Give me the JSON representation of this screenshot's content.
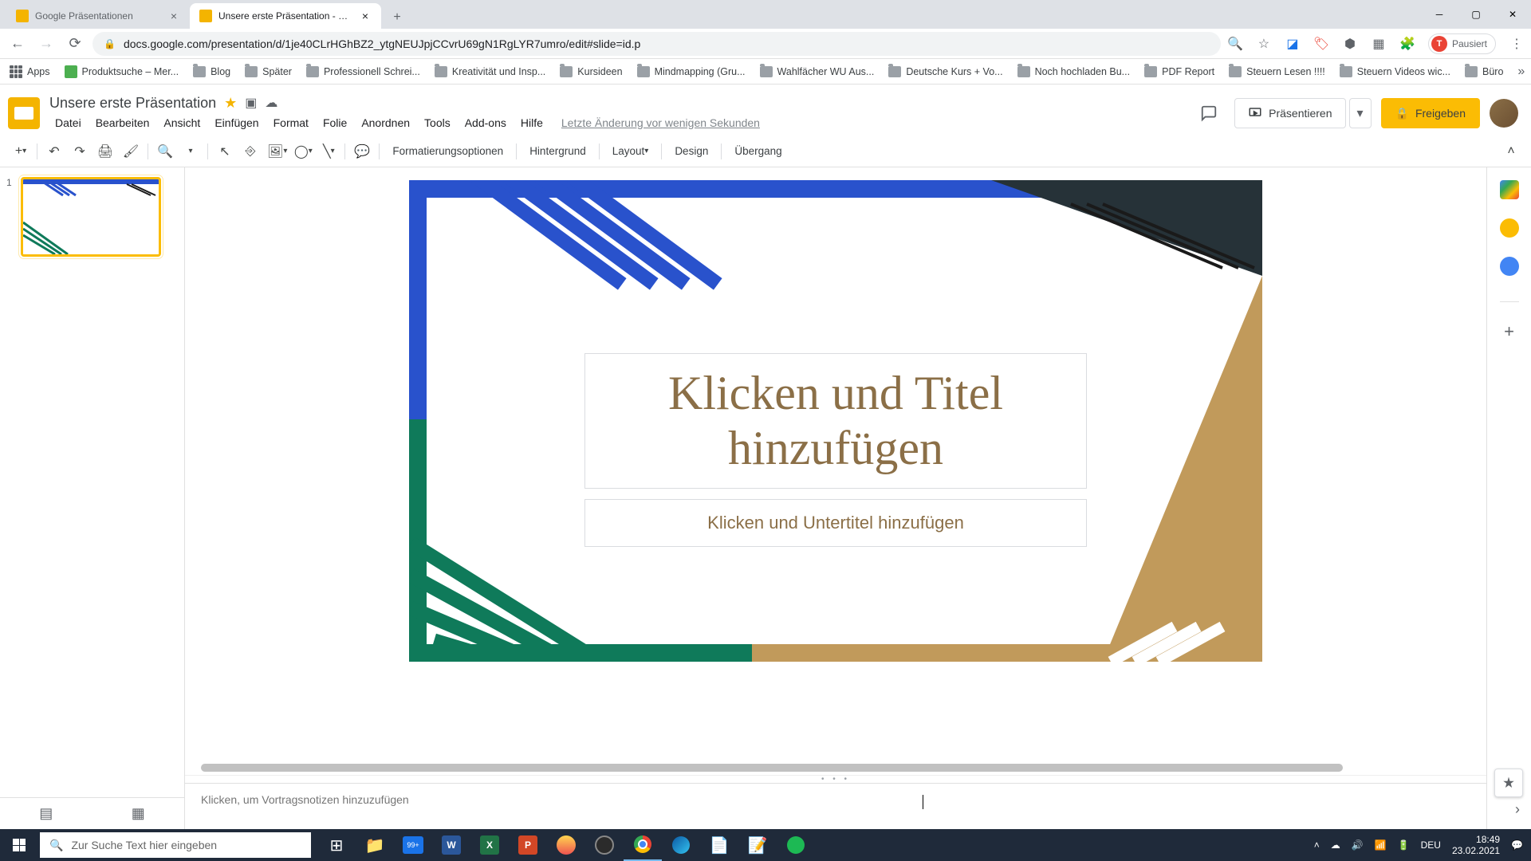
{
  "browser": {
    "tabs": [
      {
        "title": "Google Präsentationen",
        "active": false
      },
      {
        "title": "Unsere erste Präsentation - Goo...",
        "active": true
      }
    ],
    "url": "docs.google.com/presentation/d/1je40CLrHGhBZ2_ytgNEUJpjCCvrU69gN1RgLYR7umro/edit#slide=id.p",
    "pause_label": "Pausiert",
    "bookmarks": [
      "Apps",
      "Produktsuche – Mer...",
      "Blog",
      "Später",
      "Professionell Schrei...",
      "Kreativität und Insp...",
      "Kursideen",
      "Mindmapping  (Gru...",
      "Wahlfächer WU Aus...",
      "Deutsche Kurs + Vo...",
      "Noch hochladen Bu...",
      "PDF Report",
      "Steuern Lesen !!!!",
      "Steuern Videos wic...",
      "Büro"
    ]
  },
  "slides": {
    "title": "Unsere erste Präsentation",
    "menu": [
      "Datei",
      "Bearbeiten",
      "Ansicht",
      "Einfügen",
      "Format",
      "Folie",
      "Anordnen",
      "Tools",
      "Add-ons",
      "Hilfe"
    ],
    "last_edit": "Letzte Änderung vor wenigen Sekunden",
    "present": "Präsentieren",
    "share": "Freigeben",
    "toolbar_text": {
      "format_options": "Formatierungsoptionen",
      "background": "Hintergrund",
      "layout": "Layout",
      "design": "Design",
      "transition": "Übergang"
    },
    "thumb_number": "1",
    "title_placeholder": "Klicken und Titel hinzufügen",
    "subtitle_placeholder": "Klicken und Untertitel hinzufügen",
    "notes_placeholder": "Klicken, um Vortragsnotizen hinzuzufügen"
  },
  "taskbar": {
    "search_placeholder": "Zur Suche Text hier eingeben",
    "lang": "DEU",
    "time": "18:49",
    "date": "23.02.2021"
  }
}
